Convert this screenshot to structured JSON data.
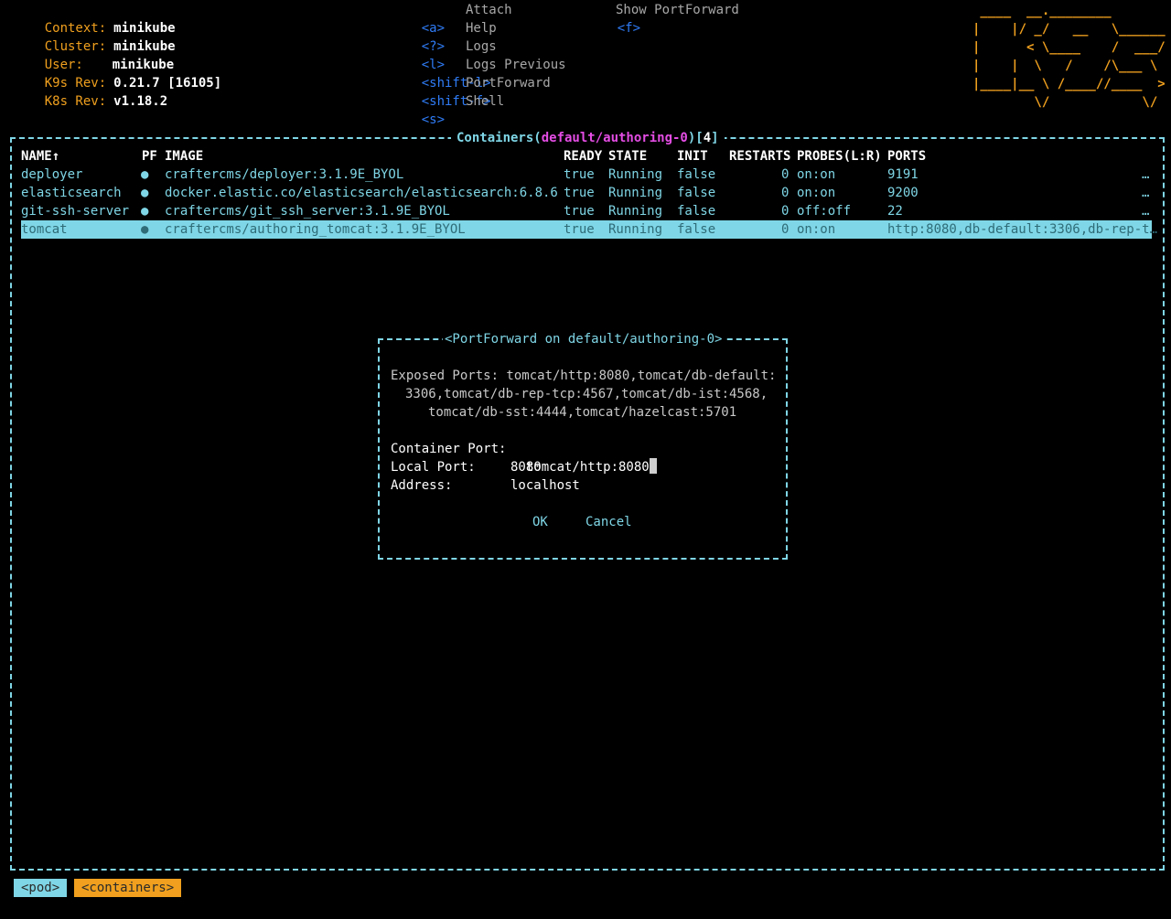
{
  "header": {
    "info": [
      {
        "key": "Context:",
        "value": "minikube"
      },
      {
        "key": "Cluster:",
        "value": "minikube"
      },
      {
        "key": "User:",
        "value": "minikube"
      },
      {
        "key": "K9s Rev:",
        "value": "0.21.7 [16105]"
      },
      {
        "key": "K8s Rev:",
        "value": "v1.18.2"
      }
    ],
    "menu_col1": [
      {
        "key": "<a>",
        "label": "Attach"
      },
      {
        "key": "<?>",
        "label": "Help"
      },
      {
        "key": "<l>",
        "label": "Logs"
      },
      {
        "key": "<shift-l>",
        "label": "Logs Previous"
      },
      {
        "key": "<shift-f>",
        "label": "PortForward"
      },
      {
        "key": "<s>",
        "label": "Shell"
      }
    ],
    "menu_col2": [
      {
        "key": "<f>",
        "label": "Show PortForward"
      }
    ],
    "logo_lines": [
      " ____  __.________       ",
      "|    |/ _/   __   \\______",
      "|      < \\____    /  ___/",
      "|    |  \\   /    /\\___ \\ ",
      "|____|__ \\ /____//____  >",
      "        \\/            \\/ "
    ]
  },
  "panel": {
    "title_prefix": "Containers(",
    "title_ns": "default/authoring-0",
    "title_mid": ")[",
    "title_count": "4",
    "title_suffix": "]"
  },
  "table": {
    "headers": [
      "NAME↑",
      "PF",
      "IMAGE",
      "READY",
      "STATE",
      "INIT",
      "RESTARTS",
      "PROBES(L:R)",
      "PORTS"
    ],
    "rows": [
      {
        "name": "deployer",
        "pf": "●",
        "image": "craftercms/deployer:3.1.9E_BYOL",
        "ready": "true",
        "state": "Running",
        "init": "false",
        "restarts": "0",
        "probes": "on:on",
        "ports": "9191",
        "more": "…"
      },
      {
        "name": "elasticsearch",
        "pf": "●",
        "image": "docker.elastic.co/elasticsearch/elasticsearch:6.8.6",
        "ready": "true",
        "state": "Running",
        "init": "false",
        "restarts": "0",
        "probes": "on:on",
        "ports": "9200",
        "more": "…"
      },
      {
        "name": "git-ssh-server",
        "pf": "●",
        "image": "craftercms/git_ssh_server:3.1.9E_BYOL",
        "ready": "true",
        "state": "Running",
        "init": "false",
        "restarts": "0",
        "probes": "off:off",
        "ports": "22",
        "more": "…"
      },
      {
        "name": "tomcat",
        "pf": "●",
        "image": "craftercms/authoring_tomcat:3.1.9E_BYOL",
        "ready": "true",
        "state": "Running",
        "init": "false",
        "restarts": "0",
        "probes": "on:on",
        "ports": "http:8080,db-default:3306,db-rep-t…",
        "more": ""
      }
    ]
  },
  "dialog": {
    "title": "<PortForward on default/authoring-0>",
    "exposed_lines": [
      "Exposed Ports: tomcat/http:8080,tomcat/db-default:",
      "3306,tomcat/db-rep-tcp:4567,tomcat/db-ist:4568,",
      "tomcat/db-sst:4444,tomcat/hazelcast:5701"
    ],
    "container_port_label": "Container Port:",
    "container_port_value": "tomcat/http:8080",
    "local_port_label": "Local Port:",
    "local_port_value": "8080",
    "address_label": "Address:",
    "address_value": "localhost",
    "ok_label": "OK",
    "cancel_label": "Cancel"
  },
  "breadcrumbs": [
    "<pod>",
    "<containers>"
  ],
  "colors": {
    "accent": "#7fd6e6",
    "orange": "#f0a01e",
    "magenta": "#e44de4",
    "blue": "#2f7cf6"
  }
}
